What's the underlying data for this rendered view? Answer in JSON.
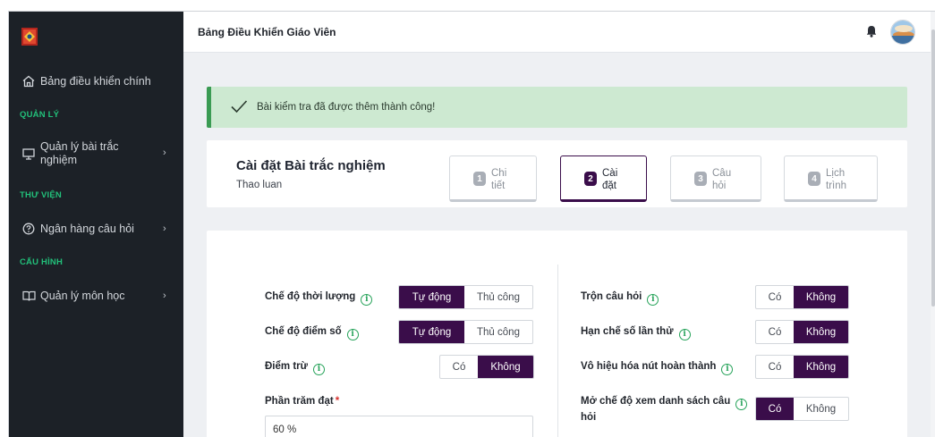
{
  "header": {
    "title": "Bảng Điều Khiển Giáo Viên"
  },
  "sidebar": {
    "dashboard": "Bảng điều khiển chính",
    "section_manage": "QUẢN LÝ",
    "quiz_manage_line1": "Quản lý bài trắc",
    "quiz_manage_line2": "nghiệm",
    "section_library": "THƯ VIỆN",
    "question_bank": "Ngân hàng câu hỏi",
    "section_config": "CẤU HÌNH",
    "subject_manage": "Quản lý môn học",
    "chevron": "›"
  },
  "alert": {
    "message": "Bài kiểm tra đã được thêm thành công!"
  },
  "quiz": {
    "title": "Cài đặt Bài trắc nghiệm",
    "subtitle": "Thao luan",
    "steps": [
      {
        "num": "1",
        "line1": "Chi",
        "line2": "tiết"
      },
      {
        "num": "2",
        "line1": "Cài",
        "line2": "đặt"
      },
      {
        "num": "3",
        "line1": "Câu",
        "line2": "hỏi"
      },
      {
        "num": "4",
        "line1": "Lịch",
        "line2": "trình"
      }
    ]
  },
  "settings": {
    "left": {
      "duration_mode": {
        "label": "Chế độ thời lượng",
        "opt1": "Tự động",
        "opt2": "Thủ công"
      },
      "score_mode": {
        "label": "Chế độ điểm số",
        "opt1": "Tự động",
        "opt2": "Thủ công"
      },
      "penalty": {
        "label": "Điểm trừ",
        "opt1": "Có",
        "opt2": "Không"
      },
      "pass_percent": {
        "label": "Phần trăm đạt",
        "required": "*",
        "value": "60 %"
      }
    },
    "right": {
      "shuffle": {
        "label": "Trộn câu hỏi",
        "opt1": "Có",
        "opt2": "Không"
      },
      "attempt_limit": {
        "label": "Hạn chế số lần thử",
        "opt1": "Có",
        "opt2": "Không"
      },
      "disable_finish": {
        "label": "Vô hiệu hóa nút hoàn thành",
        "opt1": "Có",
        "opt2": "Không"
      },
      "list_view": {
        "label_line1": "Mở chế độ xem danh sách câu",
        "label_line2": "hỏi",
        "opt1": "Có",
        "opt2": "Không"
      }
    },
    "info_glyph": "i"
  },
  "colors": {
    "primary": "#3a0d4a",
    "sidebar": "#1c2127",
    "section": "#22c07a",
    "success_bg": "#cde9d1",
    "success_border": "#3a9b53"
  }
}
